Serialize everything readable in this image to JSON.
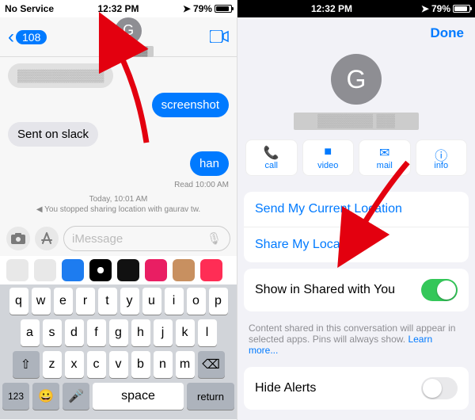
{
  "status": {
    "left": "No Service",
    "time": "12:32 PM",
    "battery": "79%",
    "loc_arrow": "➤"
  },
  "nav": {
    "back_count": "108",
    "avatar": "G",
    "name": "▓▓▓▓▓▓"
  },
  "messages": {
    "m1": "▓▓▓▓▓▓▓▓▓▓",
    "m2": "screenshot",
    "m3": "Sent on slack",
    "m4": "han",
    "read": "Read 10:00 AM",
    "sys_time": "Today, 10:01 AM",
    "sys_text": "You stopped sharing location with gaurav tw."
  },
  "composer": {
    "placeholder": "iMessage"
  },
  "kb": {
    "r1": [
      "q",
      "w",
      "e",
      "r",
      "t",
      "y",
      "u",
      "i",
      "o",
      "p"
    ],
    "r2": [
      "a",
      "s",
      "d",
      "f",
      "g",
      "h",
      "j",
      "k",
      "l"
    ],
    "r3": [
      "z",
      "x",
      "c",
      "v",
      "b",
      "n",
      "m"
    ],
    "shift": "⇧",
    "del": "⌫",
    "num": "123",
    "emoji": "😀",
    "mic": "🎤",
    "ret": "return"
  },
  "sheet": {
    "done": "Done",
    "avatar": "G",
    "name": "▓▓▓▓▓▓ ▓▓",
    "actions": [
      {
        "icon": "📞",
        "label": "call"
      },
      {
        "icon": "■",
        "label": "video"
      },
      {
        "icon": "✉",
        "label": "mail"
      },
      {
        "icon": "ⓘ",
        "label": "info"
      }
    ],
    "send_loc": "Send My Current Location",
    "share_loc": "Share My Location",
    "shared_label": "Show in Shared with You",
    "shared_on": true,
    "hint": "Content shared in this conversation will appear in selected apps. Pins will always show. ",
    "hint_link": "Learn more...",
    "hide_alerts": "Hide Alerts"
  },
  "app_colors": [
    "#e8e8e8",
    "#e8e8e8",
    "#1d7cf0",
    "#000",
    "#111",
    "#e91e63",
    "#c89060",
    "#ff2d55"
  ]
}
